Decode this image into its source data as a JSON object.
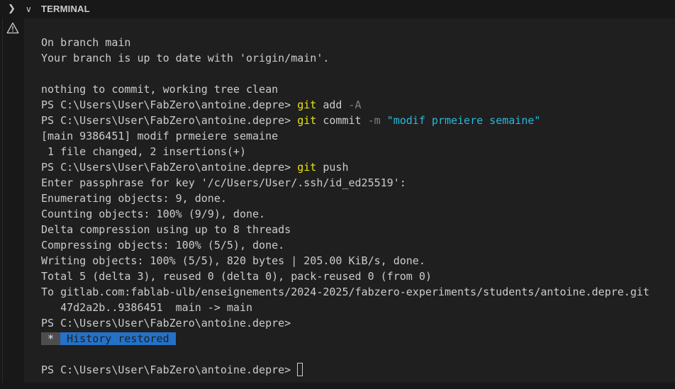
{
  "panel": {
    "title": "TERMINAL",
    "collapse_icon": "chevron-right-icon",
    "expand_icon": "chevron-down-icon",
    "warning_icon": "warning-icon"
  },
  "colors": {
    "background": "#1f1f1f",
    "text": "#cccccc",
    "command": "#e5e510",
    "flag": "#808080",
    "string": "#29b8db",
    "history_bg": "#2472c8"
  },
  "terminal": {
    "prompt": "PS C:\\Users\\User\\FabZero\\antoine.depre> ",
    "lines": {
      "l1": "On branch main",
      "l2": "Your branch is up to date with 'origin/main'.",
      "l4": "nothing to commit, working tree clean",
      "cmd1": "git",
      "cmd1_rest": " add ",
      "cmd1_flag": "-A",
      "cmd2": "git",
      "cmd2_rest": " commit ",
      "cmd2_flag": "-m",
      "cmd2_str": "\"modif prmeiere semaine\"",
      "l7": "[main 9386451] modif prmeiere semaine",
      "l8": " 1 file changed, 2 insertions(+)",
      "cmd3": "git",
      "cmd3_rest": " push",
      "l10": "Enter passphrase for key '/c/Users/User/.ssh/id_ed25519':",
      "l11": "Enumerating objects: 9, done.",
      "l12": "Counting objects: 100% (9/9), done.",
      "l13": "Delta compression using up to 8 threads",
      "l14": "Compressing objects: 100% (5/5), done.",
      "l15": "Writing objects: 100% (5/5), 820 bytes | 205.00 KiB/s, done.",
      "l16": "Total 5 (delta 3), reused 0 (delta 0), pack-reused 0 (from 0)",
      "l17": "To gitlab.com:fablab-ulb/enseignements/2024-2025/fabzero-experiments/students/antoine.depre.git",
      "l18": "   47d2a2b..9386451  main -> main",
      "history_prefix": " * ",
      "history_text": " History restored "
    }
  }
}
